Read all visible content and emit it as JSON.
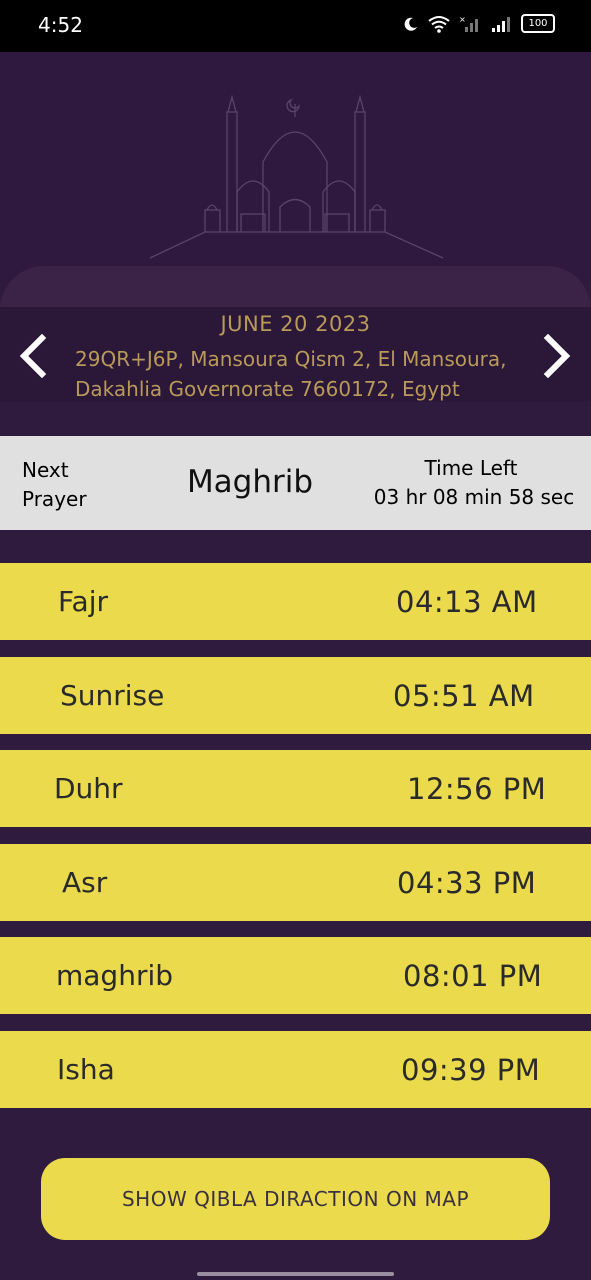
{
  "status_bar": {
    "time": "4:52",
    "battery": "100"
  },
  "header": {
    "date": "JUNE 20 2023",
    "address": "29QR+J6P, Mansoura Qism 2, El Mansoura, Dakahlia Governorate 7660172, Egypt"
  },
  "next_prayer": {
    "label": "Next Prayer",
    "name": "Maghrib",
    "time_left_label": "Time Left",
    "time_left_value": "03 hr 08 min 58 sec"
  },
  "prayers": [
    {
      "name": "Fajr",
      "time": "04:13 AM"
    },
    {
      "name": "Sunrise",
      "time": "05:51 AM"
    },
    {
      "name": "Duhr",
      "time": "12:56 PM"
    },
    {
      "name": "Asr",
      "time": "04:33 PM"
    },
    {
      "name": "maghrib",
      "time": "08:01 PM"
    },
    {
      "name": "Isha",
      "time": "09:39 PM"
    }
  ],
  "qibla_button": "SHOW QIBLA DIRACTION ON MAP",
  "colors": {
    "background": "#2f1b3d",
    "row_yellow": "#eada4c",
    "date_text": "#b89a5a"
  }
}
